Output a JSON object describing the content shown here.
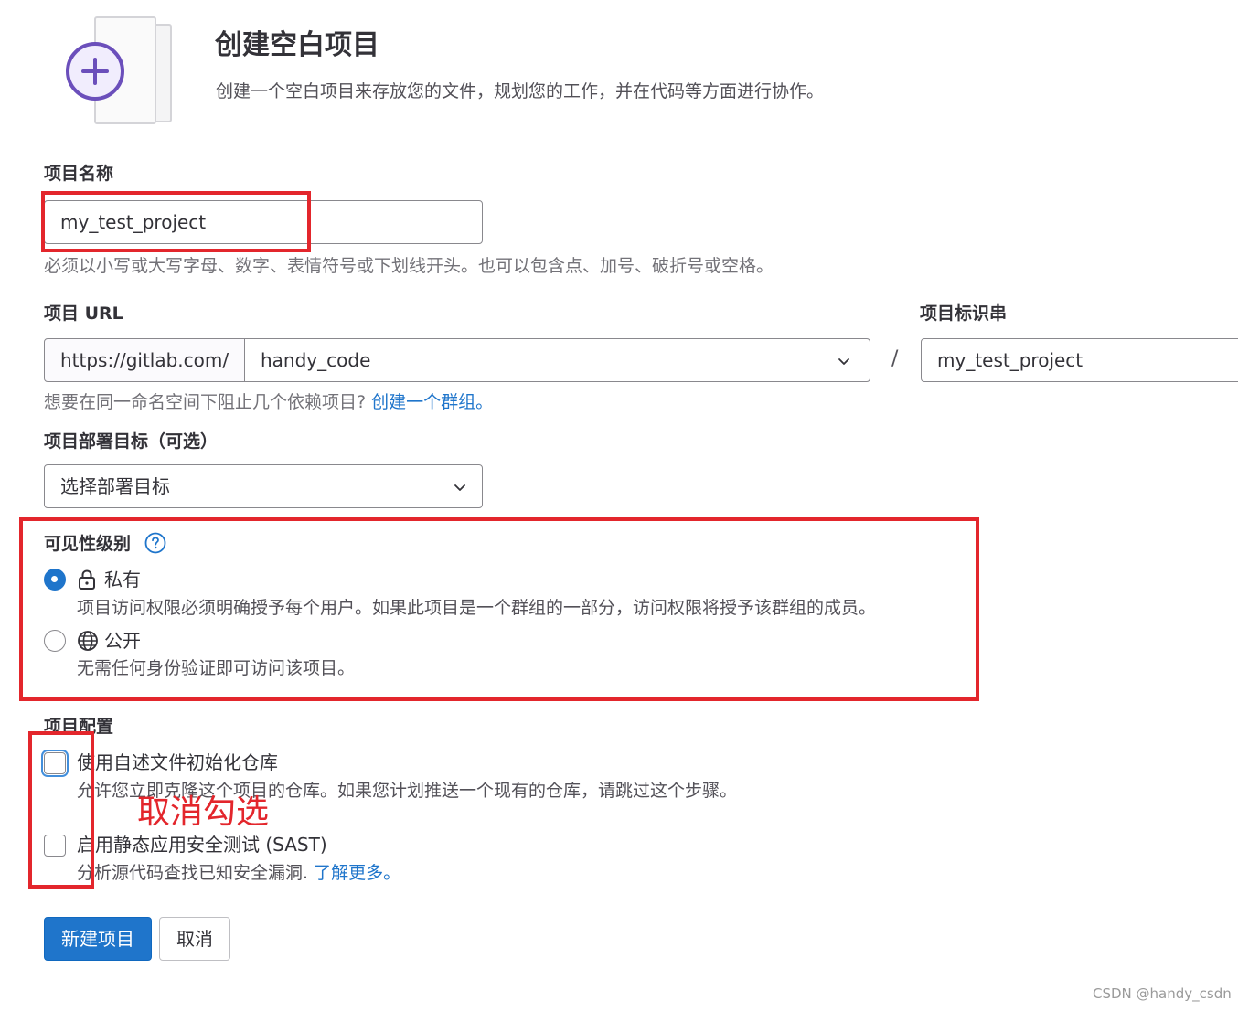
{
  "header": {
    "title": "创建空白项目",
    "subtitle": "创建一个空白项目来存放您的文件，规划您的工作，并在代码等方面进行协作。",
    "illustration_icon": "plus-icon",
    "accent_color": "#6b4fbb"
  },
  "project_name": {
    "label": "项目名称",
    "value": "my_test_project",
    "help": "必须以小写或大写字母、数字、表情符号或下划线开头。也可以包含点、加号、破折号或空格。"
  },
  "project_url": {
    "label": "项目 URL",
    "prefix": "https://gitlab.com/",
    "namespace": "handy_code",
    "separator": "/",
    "help_text": "想要在同一命名空间下阻止几个依赖项目?",
    "help_link": "创建一个群组。"
  },
  "project_slug": {
    "label": "项目标识串",
    "value": "my_test_project"
  },
  "deploy_target": {
    "label": "项目部署目标（可选）",
    "value": "选择部署目标"
  },
  "visibility": {
    "label": "可见性级别",
    "options": [
      {
        "label": "私有",
        "icon": "lock-icon",
        "help": "项目访问权限必须明确授予每个用户。如果此项目是一个群组的一部分，访问权限将授予该群组的成员。",
        "checked": true
      },
      {
        "label": "公开",
        "icon": "globe-icon",
        "help": "无需任何身份验证即可访问该项目。",
        "checked": false
      }
    ]
  },
  "project_config": {
    "label": "项目配置",
    "options": [
      {
        "label": "使用自述文件初始化仓库",
        "help": "允许您立即克隆这个项目的仓库。如果您计划推送一个现有的仓库，请跳过这个步骤。",
        "checked": false
      },
      {
        "label": "启用静态应用安全测试 (SAST)",
        "help": "分析源代码查找已知安全漏洞.",
        "help_link": "了解更多。",
        "checked": false
      }
    ]
  },
  "actions": {
    "create": "新建项目",
    "cancel": "取消"
  },
  "annotation": {
    "text": "取消勾选",
    "color": "#e3262c"
  },
  "watermark": "CSDN @handy_csdn",
  "colors": {
    "primary": "#1f75cb",
    "text": "#333238"
  }
}
